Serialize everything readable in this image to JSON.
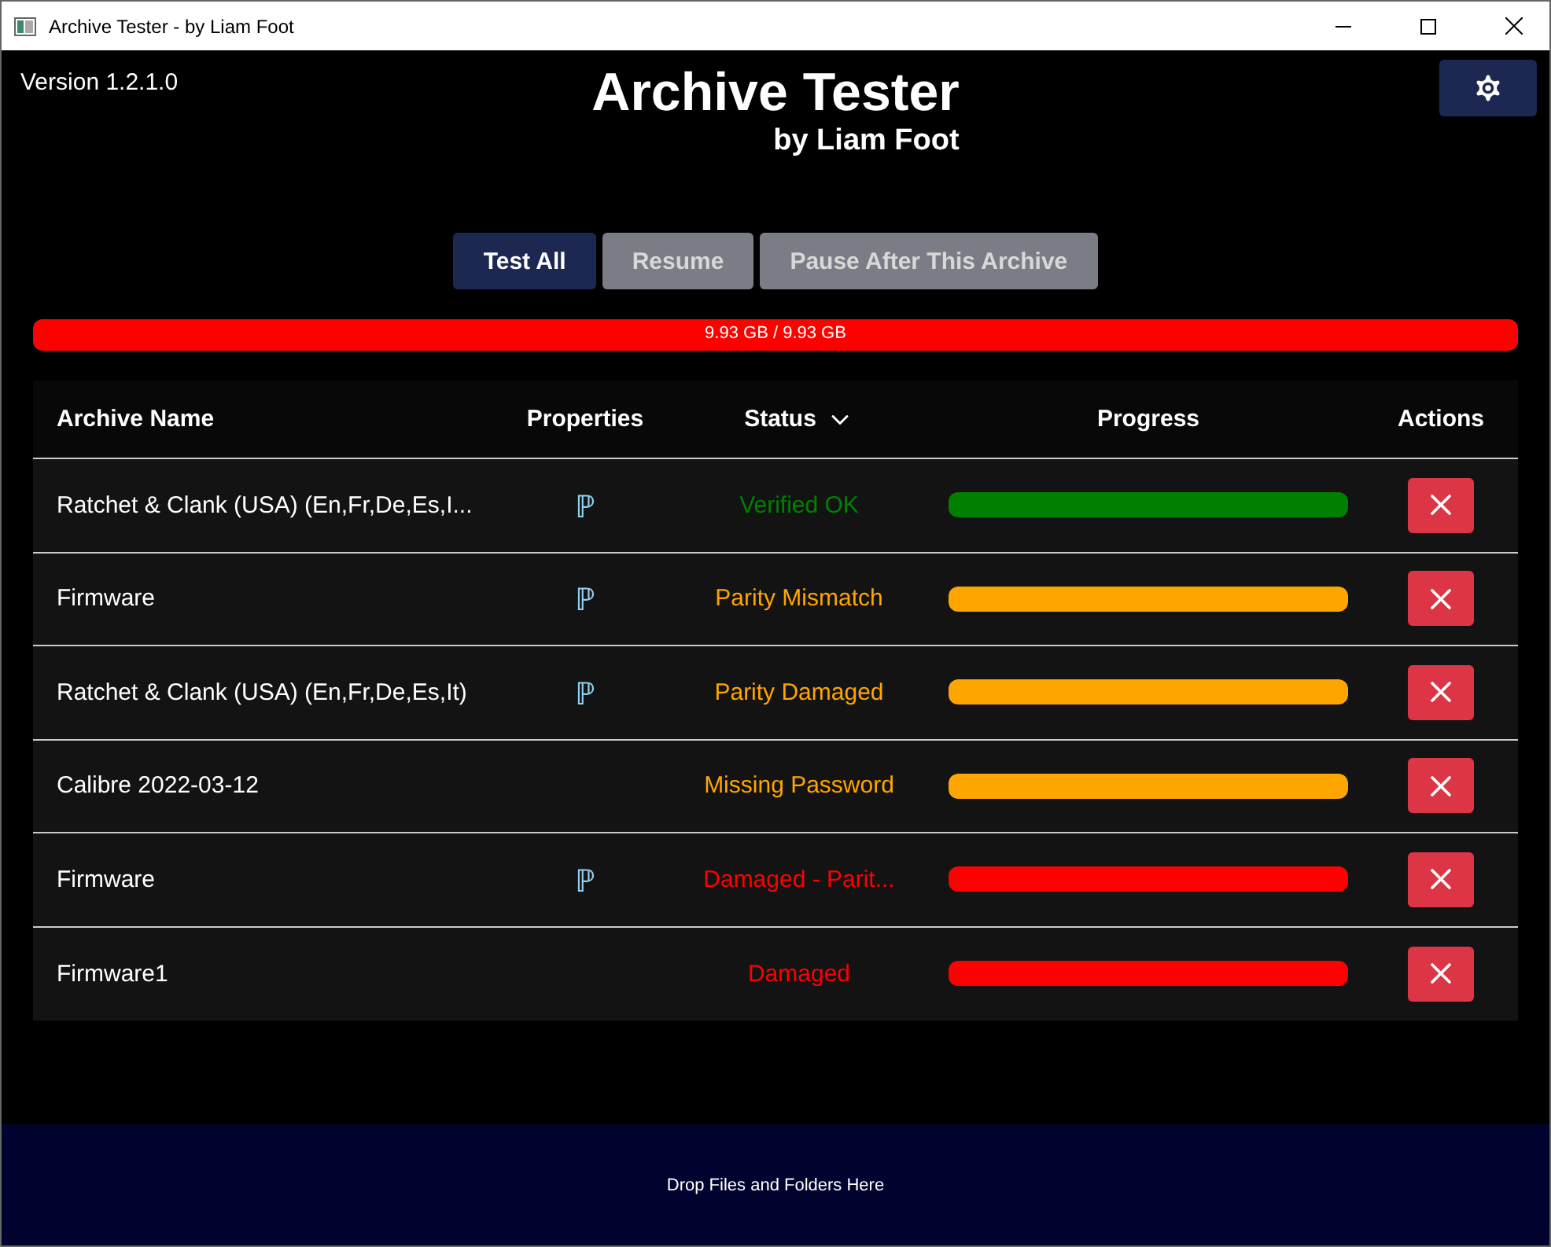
{
  "window": {
    "title": "Archive Tester - by Liam Foot"
  },
  "version": "Version 1.2.1.0",
  "app_title": "Archive Tester",
  "app_subtitle": "by Liam Foot",
  "buttons": [
    {
      "label": "Test All",
      "disabled": false
    },
    {
      "label": "Resume",
      "disabled": true
    },
    {
      "label": "Pause After This Archive",
      "disabled": true
    }
  ],
  "total_progress": {
    "level": 1,
    "reading": "9.93 GB / 9.93 GB",
    "color": "#ff0000"
  },
  "table": {
    "columns": [
      "Archive Name",
      "Properties",
      "Status",
      "Progress",
      "Actions"
    ],
    "rows": [
      {
        "name": "Ratchet & Clank (USA) (En,Fr,De,Es,I...",
        "property": "ℙ",
        "status": "Verified OK",
        "color": "#008000",
        "level": 1
      },
      {
        "name": "Firmware",
        "property": "ℙ",
        "status": "Parity Mismatch",
        "color": "#ffa500",
        "level": 1
      },
      {
        "name": "Ratchet & Clank (USA) (En,Fr,De,Es,It)",
        "property": "ℙ",
        "status": "Parity Damaged",
        "color": "#ffa500",
        "level": 1
      },
      {
        "name": "Calibre 2022-03-12",
        "status": "Missing Password",
        "color": "#ffa500",
        "level": 1
      },
      {
        "name": "Firmware",
        "property": "ℙ",
        "status": "Damaged - Parit...",
        "color": "#ff0000",
        "level": 1
      },
      {
        "name": "Firmware1",
        "status": "Damaged",
        "color": "#ff0000",
        "level": 1
      }
    ]
  },
  "drop_zone": {
    "label": "Drop Files and Folders Here"
  }
}
